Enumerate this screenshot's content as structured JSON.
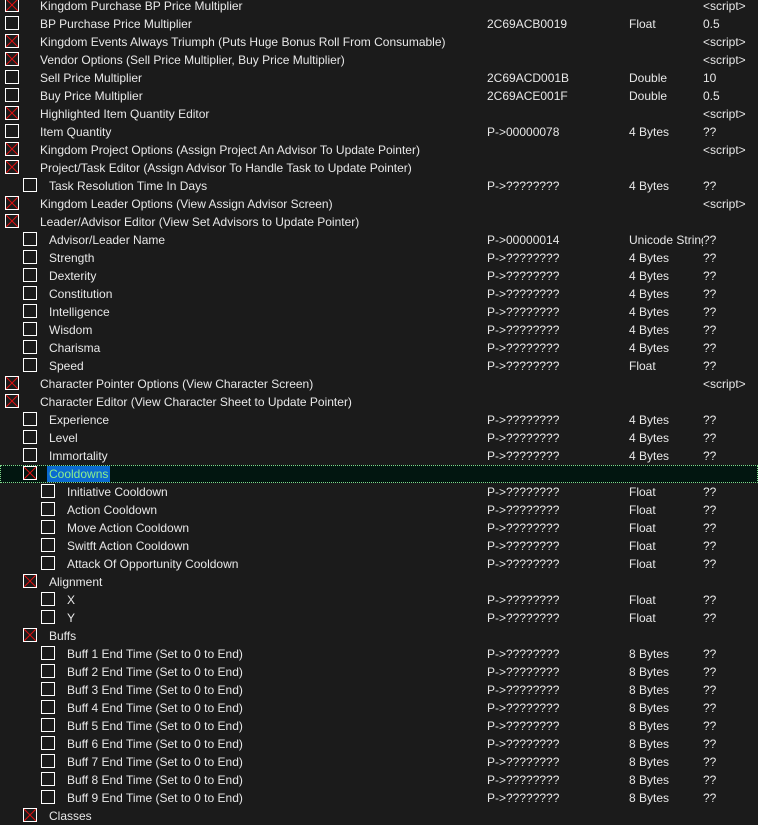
{
  "colors": {
    "check_mark": "#e01010",
    "selection_bg": "#0a6ad0",
    "selection_text": "#8cf08c",
    "row_selected_bg": "#021610",
    "focus_outline": "#7fd88a",
    "background": "#1b1b1b"
  },
  "rows": [
    {
      "level": 0,
      "checked": true,
      "description": "Kingdom Purchase BP Price Multiplier",
      "address": "",
      "type": "",
      "value": "<script>"
    },
    {
      "level": 0,
      "checked": false,
      "description": "BP Purchase Price Multiplier",
      "address": "2C69ACB0019",
      "type": "Float",
      "value": "0.5"
    },
    {
      "level": 0,
      "checked": true,
      "description": "Kingdom Events Always Triumph (Puts Huge Bonus Roll From Consumable)",
      "address": "",
      "type": "",
      "value": "<script>"
    },
    {
      "level": 0,
      "checked": true,
      "description": "Vendor Options (Sell Price Multiplier, Buy Price Multiplier)",
      "address": "",
      "type": "",
      "value": "<script>"
    },
    {
      "level": 0,
      "checked": false,
      "description": "Sell Price Multiplier",
      "address": "2C69ACD001B",
      "type": "Double",
      "value": "10"
    },
    {
      "level": 0,
      "checked": false,
      "description": "Buy Price Multiplier",
      "address": "2C69ACE001F",
      "type": "Double",
      "value": "0.5"
    },
    {
      "level": 0,
      "checked": true,
      "description": "Highlighted Item Quantity Editor",
      "address": "",
      "type": "",
      "value": "<script>"
    },
    {
      "level": 0,
      "checked": false,
      "description": "Item Quantity",
      "address": "P->00000078",
      "type": "4 Bytes",
      "value": "??"
    },
    {
      "level": 0,
      "checked": true,
      "description": "Kingdom Project Options (Assign Project An Advisor To Update Pointer)",
      "address": "",
      "type": "",
      "value": "<script>"
    },
    {
      "level": 0,
      "checked": true,
      "description": "Project/Task Editor (Assign Advisor To Handle Task to Update Pointer)",
      "address": "",
      "type": "",
      "value": ""
    },
    {
      "level": 1,
      "checked": false,
      "description": "Task Resolution Time In Days",
      "address": "P->????????",
      "type": "4 Bytes",
      "value": "??"
    },
    {
      "level": 0,
      "checked": true,
      "description": "Kingdom Leader Options (View Assign Advisor Screen)",
      "address": "",
      "type": "",
      "value": "<script>"
    },
    {
      "level": 0,
      "checked": true,
      "description": "Leader/Advisor Editor (View Set Advisors to Update Pointer)",
      "address": "",
      "type": "",
      "value": ""
    },
    {
      "level": 1,
      "checked": false,
      "description": "Advisor/Leader Name",
      "address": "P->00000014",
      "type": "Unicode String",
      "value": "??"
    },
    {
      "level": 1,
      "checked": false,
      "description": "Strength",
      "address": "P->????????",
      "type": "4 Bytes",
      "value": "??"
    },
    {
      "level": 1,
      "checked": false,
      "description": "Dexterity",
      "address": "P->????????",
      "type": "4 Bytes",
      "value": "??"
    },
    {
      "level": 1,
      "checked": false,
      "description": "Constitution",
      "address": "P->????????",
      "type": "4 Bytes",
      "value": "??"
    },
    {
      "level": 1,
      "checked": false,
      "description": "Intelligence",
      "address": "P->????????",
      "type": "4 Bytes",
      "value": "??"
    },
    {
      "level": 1,
      "checked": false,
      "description": "Wisdom",
      "address": "P->????????",
      "type": "4 Bytes",
      "value": "??"
    },
    {
      "level": 1,
      "checked": false,
      "description": "Charisma",
      "address": "P->????????",
      "type": "4 Bytes",
      "value": "??"
    },
    {
      "level": 1,
      "checked": false,
      "description": "Speed",
      "address": "P->????????",
      "type": "Float",
      "value": "??"
    },
    {
      "level": 0,
      "checked": true,
      "description": "Character Pointer Options (View Character Screen)",
      "address": "",
      "type": "",
      "value": "<script>"
    },
    {
      "level": 0,
      "checked": true,
      "description": "Character Editor (View Character Sheet to Update Pointer)",
      "address": "",
      "type": "",
      "value": ""
    },
    {
      "level": 1,
      "checked": false,
      "description": "Experience",
      "address": "P->????????",
      "type": "4 Bytes",
      "value": "??"
    },
    {
      "level": 1,
      "checked": false,
      "description": "Level",
      "address": "P->????????",
      "type": "4 Bytes",
      "value": "??"
    },
    {
      "level": 1,
      "checked": false,
      "description": "Immortality",
      "address": "P->????????",
      "type": "4 Bytes",
      "value": "??"
    },
    {
      "level": 1,
      "checked": true,
      "selected": true,
      "description": "Cooldowns",
      "address": "",
      "type": "",
      "value": ""
    },
    {
      "level": 2,
      "checked": false,
      "description": "Initiative Cooldown",
      "address": "P->????????",
      "type": "Float",
      "value": "??"
    },
    {
      "level": 2,
      "checked": false,
      "description": "Action Cooldown",
      "address": "P->????????",
      "type": "Float",
      "value": "??"
    },
    {
      "level": 2,
      "checked": false,
      "description": "Move Action Cooldown",
      "address": "P->????????",
      "type": "Float",
      "value": "??"
    },
    {
      "level": 2,
      "checked": false,
      "description": "Switft Action Cooldown",
      "address": "P->????????",
      "type": "Float",
      "value": "??"
    },
    {
      "level": 2,
      "checked": false,
      "description": "Attack Of Opportunity Cooldown",
      "address": "P->????????",
      "type": "Float",
      "value": "??"
    },
    {
      "level": 1,
      "checked": true,
      "description": "Alignment",
      "address": "",
      "type": "",
      "value": ""
    },
    {
      "level": 2,
      "checked": false,
      "description": "X",
      "address": "P->????????",
      "type": "Float",
      "value": "??"
    },
    {
      "level": 2,
      "checked": false,
      "description": "Y",
      "address": "P->????????",
      "type": "Float",
      "value": "??"
    },
    {
      "level": 1,
      "checked": true,
      "description": "Buffs",
      "address": "",
      "type": "",
      "value": ""
    },
    {
      "level": 2,
      "checked": false,
      "description": "Buff 1 End Time (Set to 0 to End)",
      "address": "P->????????",
      "type": "8 Bytes",
      "value": "??"
    },
    {
      "level": 2,
      "checked": false,
      "description": "Buff 2 End Time (Set to 0 to End)",
      "address": "P->????????",
      "type": "8 Bytes",
      "value": "??"
    },
    {
      "level": 2,
      "checked": false,
      "description": "Buff 3 End Time (Set to 0 to End)",
      "address": "P->????????",
      "type": "8 Bytes",
      "value": "??"
    },
    {
      "level": 2,
      "checked": false,
      "description": "Buff 4 End Time (Set to 0 to End)",
      "address": "P->????????",
      "type": "8 Bytes",
      "value": "??"
    },
    {
      "level": 2,
      "checked": false,
      "description": "Buff 5 End Time (Set to 0 to End)",
      "address": "P->????????",
      "type": "8 Bytes",
      "value": "??"
    },
    {
      "level": 2,
      "checked": false,
      "description": "Buff 6 End Time (Set to 0 to End)",
      "address": "P->????????",
      "type": "8 Bytes",
      "value": "??"
    },
    {
      "level": 2,
      "checked": false,
      "description": "Buff 7 End Time (Set to 0 to End)",
      "address": "P->????????",
      "type": "8 Bytes",
      "value": "??"
    },
    {
      "level": 2,
      "checked": false,
      "description": "Buff 8 End Time (Set to 0 to End)",
      "address": "P->????????",
      "type": "8 Bytes",
      "value": "??"
    },
    {
      "level": 2,
      "checked": false,
      "description": "Buff 9 End Time (Set to 0 to End)",
      "address": "P->????????",
      "type": "8 Bytes",
      "value": "??"
    },
    {
      "level": 1,
      "checked": true,
      "description": "Classes",
      "address": "",
      "type": "",
      "value": ""
    }
  ]
}
